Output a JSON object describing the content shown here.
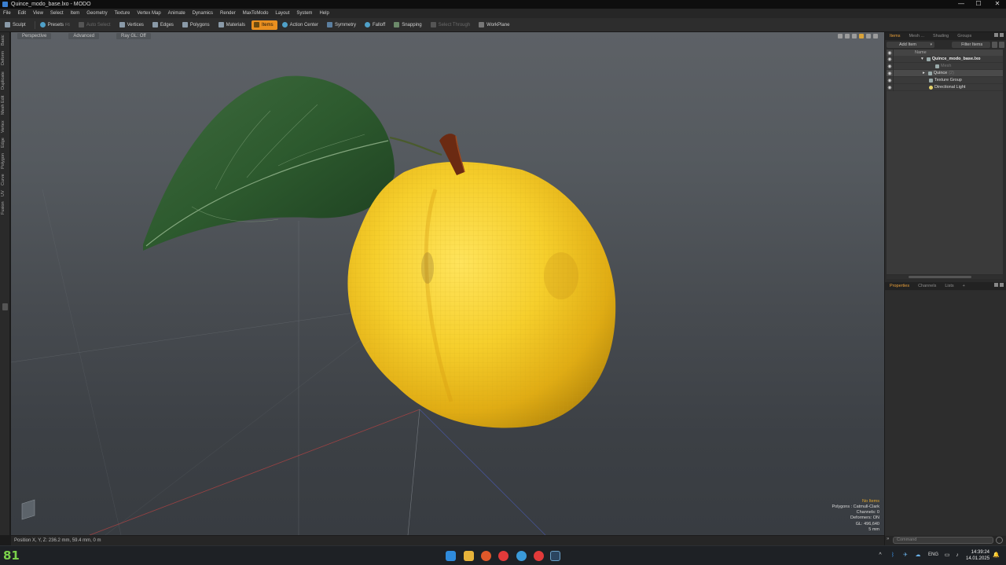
{
  "window": {
    "title": "Quince_modo_base.lxo - MODO",
    "controls": [
      "—",
      "☐",
      "✕"
    ]
  },
  "menu": [
    "File",
    "Edit",
    "View",
    "Select",
    "Item",
    "Geometry",
    "Texture",
    "Vertex Map",
    "Animate",
    "Dynamics",
    "Render",
    "MaxToModo",
    "Layout",
    "System",
    "Help"
  ],
  "toolbar": {
    "sculpt": "Sculpt",
    "presets": "Presets",
    "presets_key": "F6",
    "auto_select": "Auto Select",
    "vertices": "Vertices",
    "edges": "Edges",
    "polygons": "Polygons",
    "materials": "Materials",
    "items": "Items",
    "action_center": "Action Center",
    "symmetry": "Symmetry",
    "falloff": "Falloff",
    "snapping": "Snapping",
    "select_through": "Select Through",
    "workplane": "WorkPlane"
  },
  "left_tabs": [
    "Basic",
    "Deform",
    "Duplicate",
    "Mesh Edit",
    "Vertex",
    "Edge",
    "Polygon",
    "Curve",
    "UV",
    "Fusion"
  ],
  "viewport": {
    "view_mode": "Perspective",
    "shading": "Advanced",
    "ray_gl": "Ray GL: Off",
    "stats": {
      "no_items": "No Items",
      "polygons": "Polygons : Catmull-Clark",
      "channels": "Channels: 0",
      "deformers": "Deformers: ON",
      "gl": "GL: 496,640",
      "scale": "5 mm"
    }
  },
  "statusbar": {
    "position": "Position X, Y, Z:  236.2 mm, 59.4 mm, 0 m"
  },
  "items_panel": {
    "tabs": [
      "Items",
      "Mesh ...",
      "Shading",
      "Groups"
    ],
    "add_item": "Add Item",
    "filter_items": "Filter Items",
    "header_name": "Name",
    "rows": [
      {
        "name": "Quince_modo_base.lxo",
        "type": "scene"
      },
      {
        "name": "Mesh",
        "type": "mesh"
      },
      {
        "name": "Quince",
        "sub": "(2)",
        "type": "mesh"
      },
      {
        "name": "Texture Group",
        "type": "group"
      },
      {
        "name": "Directional Light",
        "type": "light"
      }
    ]
  },
  "properties_panel": {
    "tabs": [
      "Properties",
      "Channels",
      "Lists",
      "+"
    ]
  },
  "command": {
    "placeholder": "Command"
  },
  "taskbar": {
    "temperature": "81",
    "language": "ENG",
    "time": "14:39:24",
    "date": "14.01.2025"
  }
}
